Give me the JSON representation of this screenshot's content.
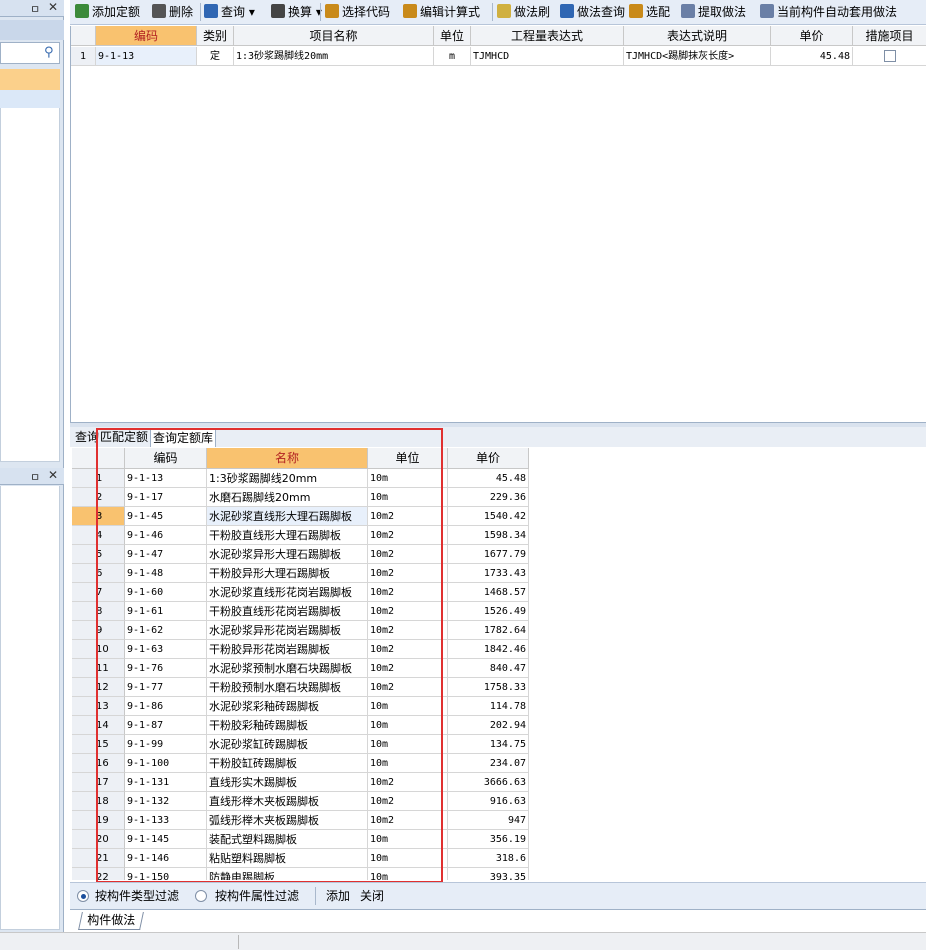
{
  "toolbar": {
    "items": [
      {
        "label": "添加定额",
        "icon": "add-quota-icon",
        "color": "#3b8a3b"
      },
      {
        "label": "删除",
        "icon": "delete-icon",
        "color": "#555555"
      },
      {
        "label": "查询",
        "icon": "search-icon",
        "color": "#2f66b3"
      },
      {
        "label": "换算",
        "icon": "formula-icon",
        "color": "#444444"
      },
      {
        "label": "选择代码",
        "icon": "select-code-icon",
        "color": "#c98a1a"
      },
      {
        "label": "编辑计算式",
        "icon": "edit-formula-icon",
        "color": "#c98a1a"
      },
      {
        "label": "做法刷",
        "icon": "brush-icon",
        "color": "#d0b040"
      },
      {
        "label": "做法查询",
        "icon": "method-query-icon",
        "color": "#2f66b3"
      },
      {
        "label": "选配",
        "icon": "match-icon",
        "color": "#c98a1a"
      },
      {
        "label": "提取做法",
        "icon": "extract-icon",
        "color": "#6a7fa6"
      },
      {
        "label": "当前构件自动套用做法",
        "icon": "auto-apply-icon",
        "color": "#6a7fa6"
      }
    ]
  },
  "upper_table": {
    "headers": [
      "编码",
      "类别",
      "项目名称",
      "单位",
      "工程量表达式",
      "表达式说明",
      "单价",
      "措施项目"
    ],
    "rows": [
      {
        "num": "1",
        "code": "9-1-13",
        "type": "定",
        "name": "1:3砂浆踢脚线20mm",
        "unit": "m",
        "expr": "TJMHCD",
        "desc": "TJMHCD<踢脚抹灰长度>",
        "price": "45.48",
        "measure": false
      }
    ]
  },
  "tabs": [
    {
      "label": "查询"
    },
    {
      "label": "匹配定额"
    },
    {
      "label": "查询定额库"
    }
  ],
  "lower_table": {
    "headers": [
      "编码",
      "名称",
      "单位",
      "单价"
    ],
    "rows": [
      {
        "num": "1",
        "code": "9-1-13",
        "name": "1:3砂浆踢脚线20mm",
        "unit": "10m",
        "price": "45.48"
      },
      {
        "num": "2",
        "code": "9-1-17",
        "name": "水磨石踢脚线20mm",
        "unit": "10m",
        "price": "229.36"
      },
      {
        "num": "3",
        "code": "9-1-45",
        "name": "水泥砂浆直线形大理石踢脚板",
        "unit": "10m2",
        "price": "1540.42"
      },
      {
        "num": "4",
        "code": "9-1-46",
        "name": "干粉胶直线形大理石踢脚板",
        "unit": "10m2",
        "price": "1598.34"
      },
      {
        "num": "5",
        "code": "9-1-47",
        "name": "水泥砂浆异形大理石踢脚板",
        "unit": "10m2",
        "price": "1677.79"
      },
      {
        "num": "6",
        "code": "9-1-48",
        "name": "干粉胶异形大理石踢脚板",
        "unit": "10m2",
        "price": "1733.43"
      },
      {
        "num": "7",
        "code": "9-1-60",
        "name": "水泥砂浆直线形花岗岩踢脚板",
        "unit": "10m2",
        "price": "1468.57"
      },
      {
        "num": "8",
        "code": "9-1-61",
        "name": "干粉胶直线形花岗岩踢脚板",
        "unit": "10m2",
        "price": "1526.49"
      },
      {
        "num": "9",
        "code": "9-1-62",
        "name": "水泥砂浆异形花岗岩踢脚板",
        "unit": "10m2",
        "price": "1782.64"
      },
      {
        "num": "10",
        "code": "9-1-63",
        "name": "干粉胶异形花岗岩踢脚板",
        "unit": "10m2",
        "price": "1842.46"
      },
      {
        "num": "11",
        "code": "9-1-76",
        "name": "水泥砂浆预制水磨石块踢脚板",
        "unit": "10m2",
        "price": "840.47"
      },
      {
        "num": "12",
        "code": "9-1-77",
        "name": "干粉胶预制水磨石块踢脚板",
        "unit": "10m2",
        "price": "1758.33"
      },
      {
        "num": "13",
        "code": "9-1-86",
        "name": "水泥砂浆彩釉砖踢脚板",
        "unit": "10m",
        "price": "114.78"
      },
      {
        "num": "14",
        "code": "9-1-87",
        "name": "干粉胶彩釉砖踢脚板",
        "unit": "10m",
        "price": "202.94"
      },
      {
        "num": "15",
        "code": "9-1-99",
        "name": "水泥砂浆缸砖踢脚板",
        "unit": "10m",
        "price": "134.75"
      },
      {
        "num": "16",
        "code": "9-1-100",
        "name": "干粉胶缸砖踢脚板",
        "unit": "10m",
        "price": "234.07"
      },
      {
        "num": "17",
        "code": "9-1-131",
        "name": "直线形实木踢脚板",
        "unit": "10m2",
        "price": "3666.63"
      },
      {
        "num": "18",
        "code": "9-1-132",
        "name": "直线形榉木夹板踢脚板",
        "unit": "10m2",
        "price": "916.63"
      },
      {
        "num": "19",
        "code": "9-1-133",
        "name": "弧线形榉木夹板踢脚板",
        "unit": "10m2",
        "price": "947"
      },
      {
        "num": "20",
        "code": "9-1-145",
        "name": "装配式塑料踢脚板",
        "unit": "10m",
        "price": "356.19"
      },
      {
        "num": "21",
        "code": "9-1-146",
        "name": "粘贴塑料踢脚板",
        "unit": "10m",
        "price": "318.6"
      },
      {
        "num": "22",
        "code": "9-1-150",
        "name": "防静电踢脚板",
        "unit": "10m",
        "price": "393.35"
      }
    ],
    "selected_row": 3
  },
  "filter": {
    "option1": "按构件类型过滤",
    "option2": "按构件属性过滤",
    "add": "添加",
    "close": "关闭"
  },
  "bottom_tab": "构件做法",
  "colors": {
    "selected_header": "#f9c26f",
    "highlight_box": "#e03030",
    "panel_bg": "#dde6f1"
  }
}
